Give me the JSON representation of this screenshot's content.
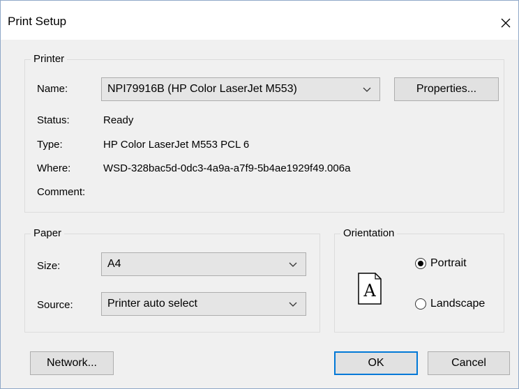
{
  "window": {
    "title": "Print Setup"
  },
  "printer": {
    "group_label": "Printer",
    "name_label": "Name:",
    "name_value": "NPI79916B (HP Color LaserJet M553)",
    "properties_button": "Properties...",
    "status_label": "Status:",
    "status_value": "Ready",
    "type_label": "Type:",
    "type_value": "HP Color LaserJet M553 PCL 6",
    "where_label": "Where:",
    "where_value": "WSD-328bac5d-0dc3-4a9a-a7f9-5b4ae1929f49.006a",
    "comment_label": "Comment:",
    "comment_value": ""
  },
  "paper": {
    "group_label": "Paper",
    "size_label": "Size:",
    "size_value": "A4",
    "source_label": "Source:",
    "source_value": "Printer auto select"
  },
  "orientation": {
    "group_label": "Orientation",
    "icon_letter": "A",
    "portrait_label": "Portrait",
    "landscape_label": "Landscape",
    "selected": "Portrait"
  },
  "buttons": {
    "network": "Network...",
    "ok": "OK",
    "cancel": "Cancel"
  },
  "icons": {
    "close": "close-icon",
    "dropdown": "chevron-down-icon",
    "orientation": "document-portrait-icon"
  }
}
